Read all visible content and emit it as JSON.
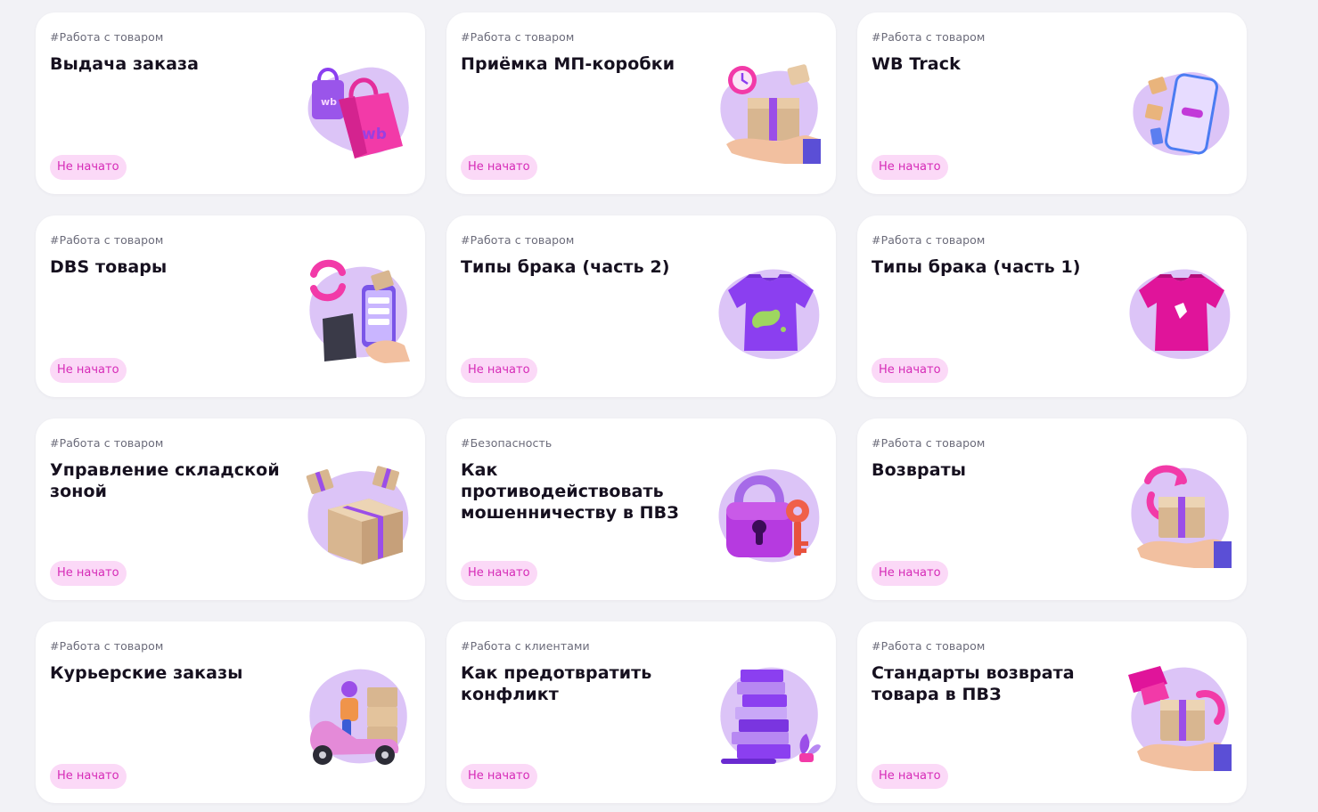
{
  "colors": {
    "page_background": "#f2f2f6",
    "card_background": "#ffffff",
    "status_badge_background": "#fbd9f7",
    "status_badge_text": "#d62bb7",
    "blob": "#dcc4f7",
    "accent_purple": "#8b3ff0",
    "accent_pink": "#f23aa8"
  },
  "cards": [
    {
      "tag": "#Работа с товаром",
      "title": "Выдача заказа",
      "status": "Не начато",
      "illustration": "shopping-bags-icon"
    },
    {
      "tag": "#Работа с товаром",
      "title": "Приёмка МП-коробки",
      "status": "Не начато",
      "illustration": "box-in-hand-icon"
    },
    {
      "tag": "#Работа с товаром",
      "title": "WB Track",
      "status": "Не начато",
      "illustration": "phone-tracking-icon"
    },
    {
      "tag": "#Работа с товаром",
      "title": "DBS товары",
      "status": "Не начато",
      "illustration": "phone-checklist-icon"
    },
    {
      "tag": "#Работа с товаром",
      "title": "Типы брака (часть 2)",
      "status": "Не начато",
      "illustration": "stained-tshirt-icon"
    },
    {
      "tag": "#Работа с товаром",
      "title": "Типы брака (часть 1)",
      "status": "Не начато",
      "illustration": "torn-tshirt-icon"
    },
    {
      "tag": "#Работа с товаром",
      "title": "Управление складской зоной",
      "status": "Не начато",
      "illustration": "warehouse-boxes-icon"
    },
    {
      "tag": "#Безопасность",
      "title": "Как противодействовать мошенничеству в ПВЗ",
      "status": "Не начато",
      "illustration": "padlock-key-icon"
    },
    {
      "tag": "#Работа с товаром",
      "title": "Возвраты",
      "status": "Не начато",
      "illustration": "return-box-icon"
    },
    {
      "tag": "#Работа с товаром",
      "title": "Курьерские заказы",
      "status": "Не начато",
      "illustration": "courier-scooter-icon"
    },
    {
      "tag": "#Работа с клиентами",
      "title": "Как предотвратить конфликт",
      "status": "Не начато",
      "illustration": "books-stack-icon"
    },
    {
      "tag": "#Работа с товаром",
      "title": "Стандарты возврата товара в ПВЗ",
      "status": "Не начато",
      "illustration": "return-standards-icon"
    }
  ]
}
